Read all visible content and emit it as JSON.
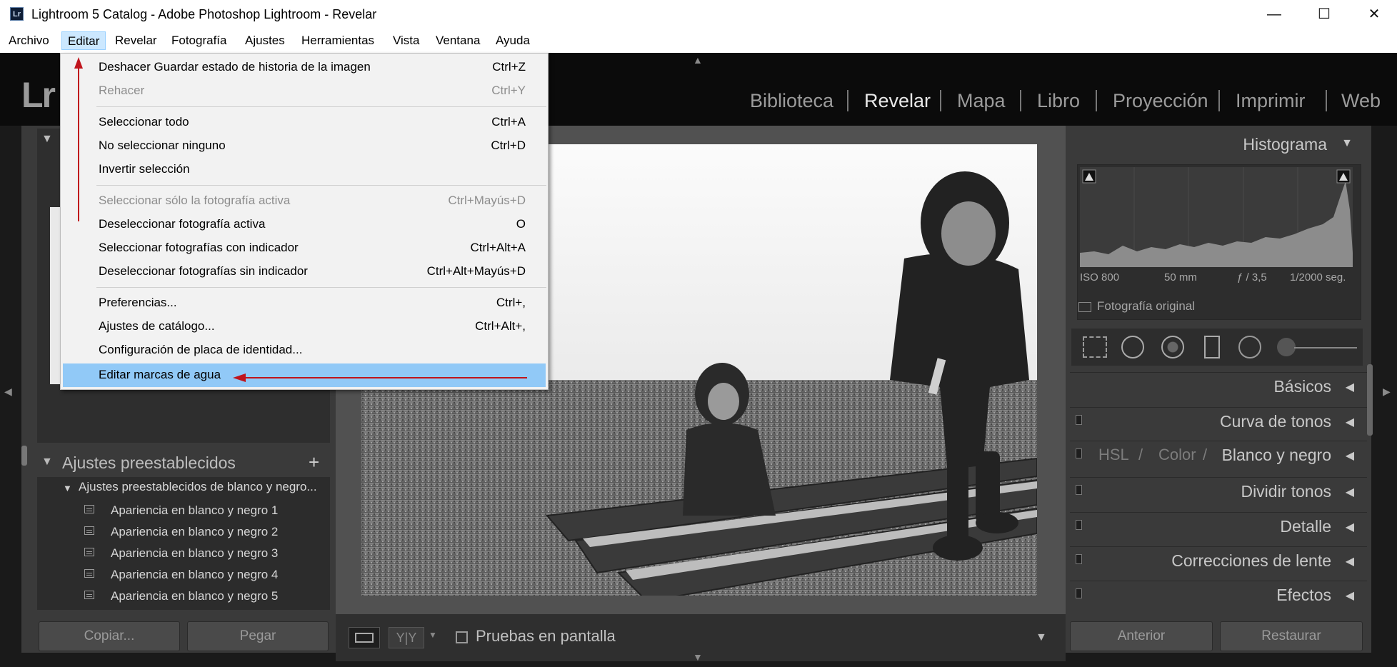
{
  "window": {
    "app_icon": "Lr",
    "title": "Lightroom 5 Catalog - Adobe Photoshop Lightroom - Revelar",
    "controls": {
      "minimize": "—",
      "maximize": "☐",
      "close": "✕"
    }
  },
  "menubar": [
    "Archivo",
    "Editar",
    "Revelar",
    "Fotografía",
    "Ajustes",
    "Herramientas",
    "Vista",
    "Ventana",
    "Ayuda"
  ],
  "logo": "Lr",
  "modules": [
    "Biblioteca",
    "Revelar",
    "Mapa",
    "Libro",
    "Proyección",
    "Imprimir",
    "Web"
  ],
  "edit_menu": {
    "items": [
      {
        "label": "Deshacer Guardar estado de historia de la imagen",
        "shortcut": "Ctrl+Z",
        "enabled": true
      },
      {
        "label": "Rehacer",
        "shortcut": "Ctrl+Y",
        "enabled": false
      },
      {
        "label": "Seleccionar todo",
        "shortcut": "Ctrl+A",
        "enabled": true
      },
      {
        "label": "No seleccionar ninguno",
        "shortcut": "Ctrl+D",
        "enabled": true
      },
      {
        "label": "Invertir selección",
        "shortcut": "",
        "enabled": true
      },
      {
        "label": "Seleccionar sólo la fotografía activa",
        "shortcut": "Ctrl+Mayús+D",
        "enabled": false
      },
      {
        "label": "Deseleccionar fotografía activa",
        "shortcut": "O",
        "enabled": true
      },
      {
        "label": "Seleccionar fotografías con indicador",
        "shortcut": "Ctrl+Alt+A",
        "enabled": true
      },
      {
        "label": "Deseleccionar fotografías sin indicador",
        "shortcut": "Ctrl+Alt+Mayús+D",
        "enabled": true
      },
      {
        "label": "Preferencias...",
        "shortcut": "Ctrl+,",
        "enabled": true
      },
      {
        "label": "Ajustes de catálogo...",
        "shortcut": "Ctrl+Alt+,",
        "enabled": true
      },
      {
        "label": "Configuración de placa de identidad...",
        "shortcut": "",
        "enabled": true
      },
      {
        "label": "Editar marcas de agua",
        "shortcut": "",
        "enabled": true,
        "highlighted": true
      }
    ]
  },
  "left_panel": {
    "presets_title": "Ajustes preestablecidos",
    "add_symbol": "+",
    "folder": "Ajustes preestablecidos de blanco y negro...",
    "presets": [
      "Apariencia en blanco y negro 1",
      "Apariencia en blanco y negro 2",
      "Apariencia en blanco y negro 3",
      "Apariencia en blanco y negro 4",
      "Apariencia en blanco y negro 5"
    ],
    "copy_button": "Copiar...",
    "paste_button": "Pegar"
  },
  "toolbar": {
    "proof_label": "Pruebas en pantalla",
    "yy_label": "Y|Y"
  },
  "right_panel": {
    "histogram_title": "Histograma",
    "iso": "ISO 800",
    "focal": "50 mm",
    "aperture": "ƒ / 3,5",
    "shutter": "1/2000 seg.",
    "original_label": "Fotografía original",
    "sections": [
      "Básicos",
      "Curva de tonos",
      "Dividir tonos",
      "Detalle",
      "Correcciones de lente",
      "Efectos"
    ],
    "hsl_tabs": [
      "HSL",
      "/",
      "Color",
      "/",
      "Blanco y negro"
    ],
    "prev_button": "Anterior",
    "reset_button": "Restaurar"
  },
  "colors": {
    "menu_highlight": "#91c9f7",
    "annotation_arrow": "#c0141c"
  }
}
